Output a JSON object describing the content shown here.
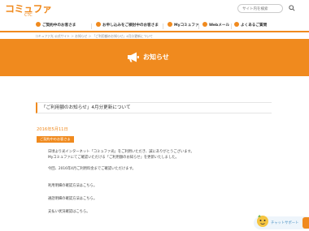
{
  "header": {
    "logo_main": "コミュファ",
    "logo_sub": "CTC",
    "search_placeholder": "サイト内を検索"
  },
  "gnav": {
    "items": [
      {
        "label": "ご契約中のお客さま"
      },
      {
        "label": "お申し込みをご検討中のお客さま"
      },
      {
        "label": "Myコミュファ"
      },
      {
        "label": "Webメール"
      },
      {
        "label": "よくあるご質問"
      }
    ]
  },
  "breadcrumb": "コミュファ光 公式サイト ＞ お知らせ ＞ 「ご利用額のお知らせ」4月分更新について",
  "hero": {
    "title": "お知らせ"
  },
  "article": {
    "title": "「ご利用額のお知らせ」4月分更新について",
    "date": "2016年5月11日",
    "tag": "ご契約中のお客さま",
    "paragraphs": [
      "日頃より光インターネット「コミュファ光」をご利用いただき、誠にありがとうございます。",
      "Myコミュファにてご確認いただける「ご利用額のお知らせ」を更新いたしました。",
      "今回、2016年4月ご利用料金までご確認いただけます。",
      "利用明細の確認方法はこちら。",
      "通話明細の確認方法はこちら。",
      "支払い状況確認はこちら。"
    ]
  },
  "chat": {
    "label": "チャットサポート"
  },
  "colors": {
    "accent": "#f08a1e",
    "chat_bg": "#eef5fb"
  }
}
